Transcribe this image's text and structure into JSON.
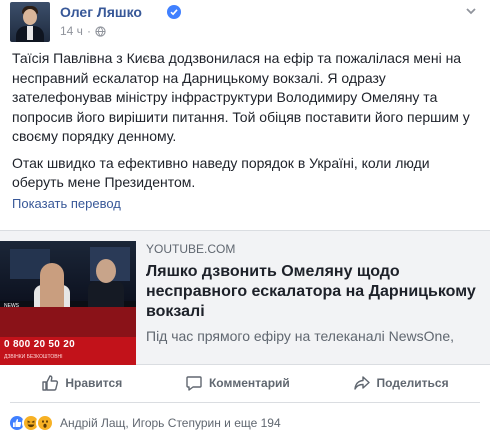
{
  "post": {
    "author": "Олег Ляшко",
    "time": "14 ч",
    "paragraphs": [
      "Таїсія Павлівна з Києва додзвонилася на ефір та пожалілася мені на несправний ескалатор на Дарницькому вокзалі. Я одразу зателефонував міністру інфраструктури Володимиру Омеляну та попросив його вирішити питання. Той обіцяв поставити його першим у своєму порядку денному.",
      "Отак швидко та ефективно наведу порядок в Україні, коли люди оберуть мене Президентом."
    ],
    "translate_label": "Показать перевод"
  },
  "link": {
    "domain": "YOUTUBE.COM",
    "title": "Ляшко дзвонить Омеляну щодо несправного ескалатора на Дарницькому вокзалі",
    "description": "Під час прямого ефіру на телеканалі NewsOne,",
    "thumb_phone": "0 800 20 50 20",
    "thumb_caption": "ДЗВІНКИ БЕЗКОШТОВНІ",
    "thumb_channel": "NEWS"
  },
  "actions": {
    "like": "Нравится",
    "comment": "Комментарий",
    "share": "Поделиться"
  },
  "reactions": {
    "summary": "Андрій Лащ, Игорь Степурин и еще 194",
    "types": [
      "like-icon",
      "haha-icon",
      "wow-icon"
    ]
  },
  "colors": {
    "link": "#385898",
    "secondary": "#606770",
    "verified": "#4080ff"
  }
}
